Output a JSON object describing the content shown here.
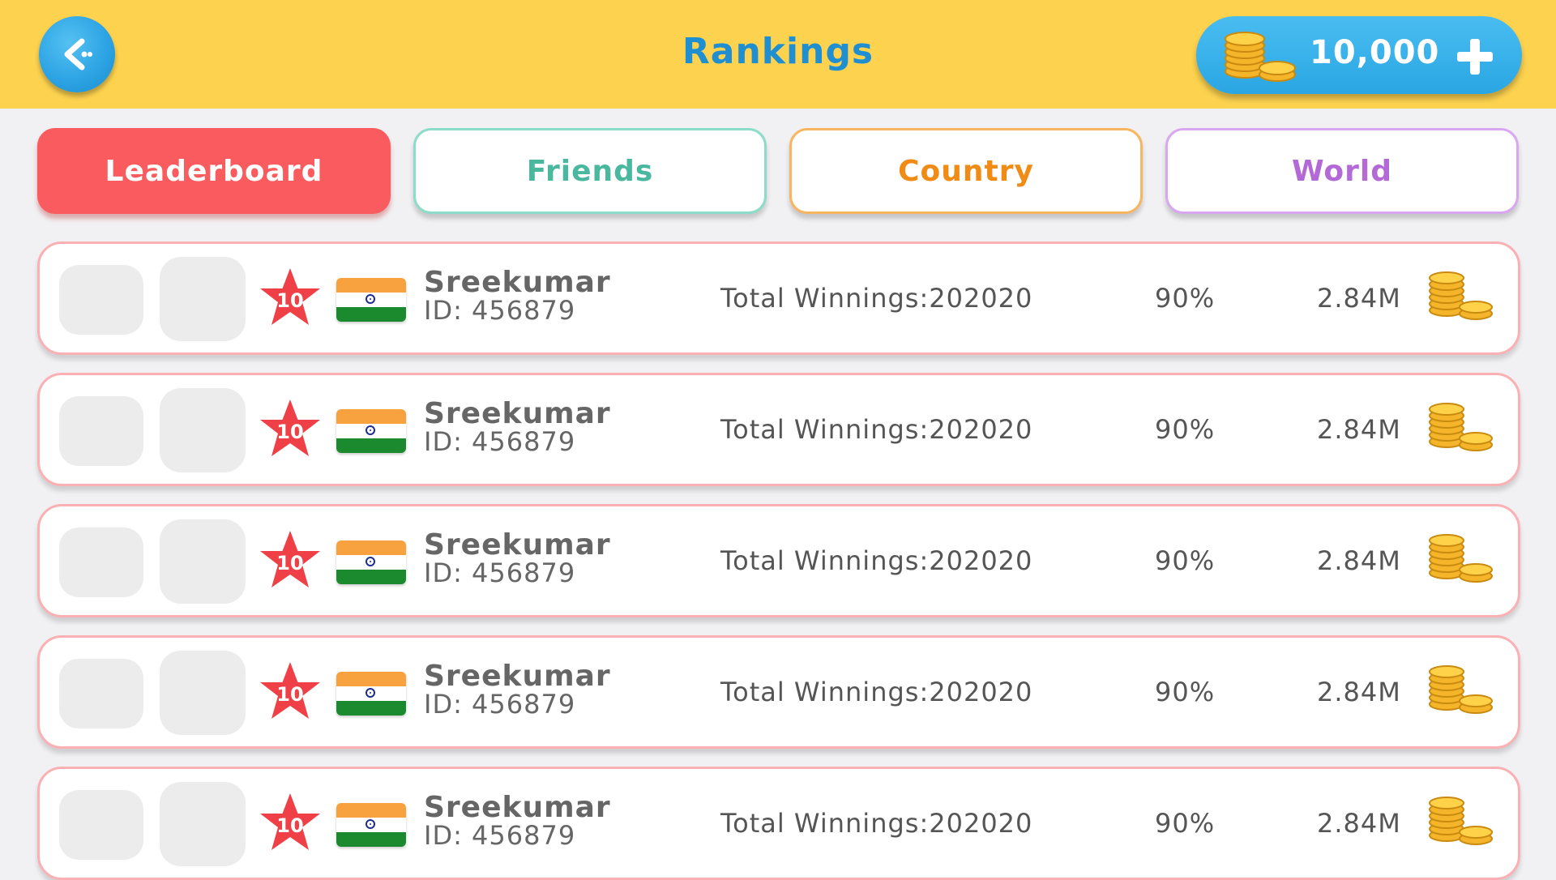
{
  "header": {
    "title": "Rankings",
    "coin_balance": "10,000",
    "colors": {
      "bar": "#fdd24f",
      "accent": "#2aa6e3"
    }
  },
  "tabs": [
    {
      "label": "Leaderboard",
      "active": true,
      "color": "#f95b5e"
    },
    {
      "label": "Friends",
      "active": false,
      "color": "#4ab89e"
    },
    {
      "label": "Country",
      "active": false,
      "color": "#f08b16"
    },
    {
      "label": "World",
      "active": false,
      "color": "#b46ad6"
    }
  ],
  "rows": [
    {
      "rank": "10",
      "country_flag": "india-flag-icon",
      "name": "Sreekumar",
      "id": "ID: 456879",
      "winnings": "Total Winnings:202020",
      "percent": "90%",
      "amount": "2.84M"
    },
    {
      "rank": "10",
      "country_flag": "india-flag-icon",
      "name": "Sreekumar",
      "id": "ID: 456879",
      "winnings": "Total Winnings:202020",
      "percent": "90%",
      "amount": "2.84M"
    },
    {
      "rank": "10",
      "country_flag": "india-flag-icon",
      "name": "Sreekumar",
      "id": "ID: 456879",
      "winnings": "Total Winnings:202020",
      "percent": "90%",
      "amount": "2.84M"
    },
    {
      "rank": "10",
      "country_flag": "india-flag-icon",
      "name": "Sreekumar",
      "id": "ID: 456879",
      "winnings": "Total Winnings:202020",
      "percent": "90%",
      "amount": "2.84M"
    },
    {
      "rank": "10",
      "country_flag": "india-flag-icon",
      "name": "Sreekumar",
      "id": "ID: 456879",
      "winnings": "Total Winnings:202020",
      "percent": "90%",
      "amount": "2.84M"
    }
  ]
}
